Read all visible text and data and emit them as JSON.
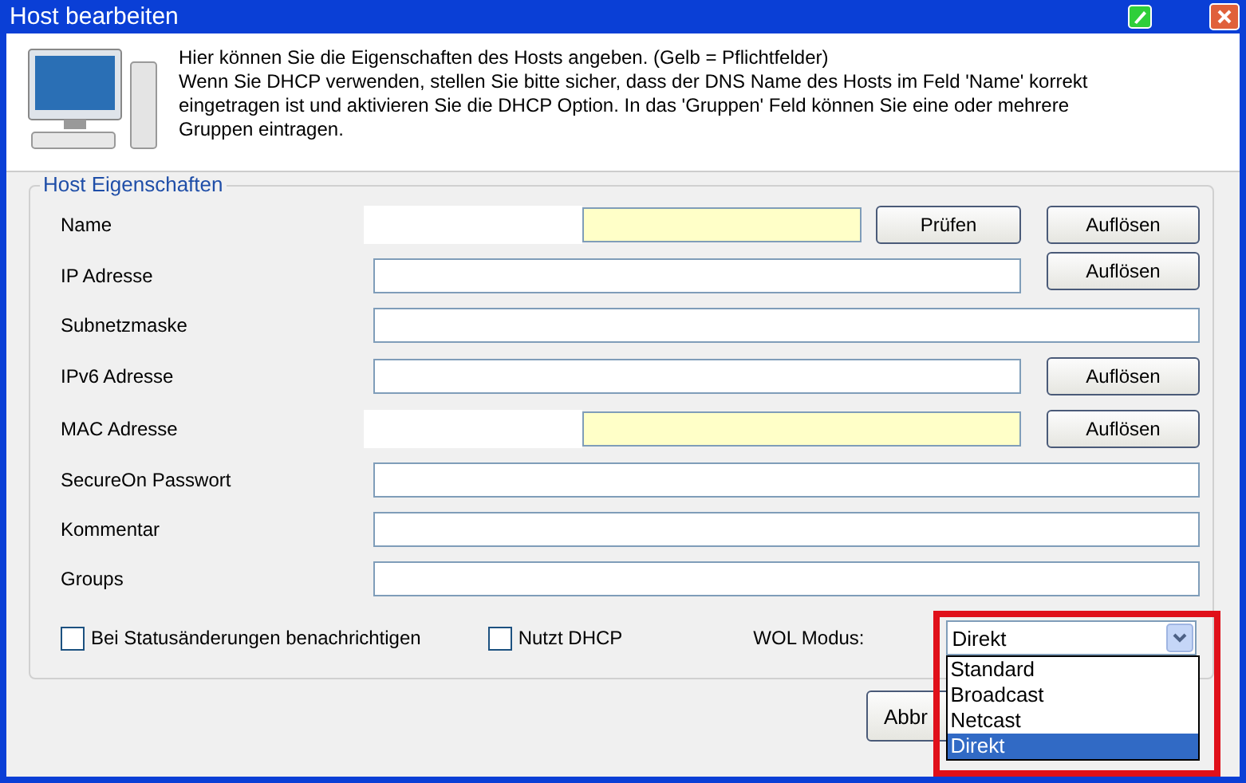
{
  "window": {
    "title": "Host bearbeiten"
  },
  "intro": {
    "lines": [
      "Hier können Sie die Eigenschaften des Hosts angeben. (Gelb = Pflichtfelder)",
      "Wenn Sie DHCP verwenden, stellen Sie bitte sicher, dass der DNS Name des Hosts im Feld 'Name' korrekt eingetragen ist und aktivieren Sie die DHCP Option. In das 'Gruppen' Feld können Sie eine oder mehrere Gruppen eintragen."
    ]
  },
  "group": {
    "title": "Host Eigenschaften",
    "fields": [
      {
        "label": "Name",
        "required": true,
        "redacted": true,
        "buttons": [
          "Prüfen",
          "Auflösen"
        ]
      },
      {
        "label": "IP Adresse",
        "required": false,
        "buttons": [
          "Auflösen"
        ]
      },
      {
        "label": "Subnetzmaske",
        "required": false
      },
      {
        "label": "IPv6 Adresse",
        "required": false,
        "buttons": [
          "Auflösen"
        ]
      },
      {
        "label": "MAC Adresse",
        "required": true,
        "redacted": true,
        "buttons": [
          "Auflösen"
        ]
      },
      {
        "label": "SecureOn Passwort",
        "required": false
      },
      {
        "label": "Kommentar",
        "required": false
      },
      {
        "label": "Groups",
        "required": false
      }
    ],
    "checkboxes": [
      {
        "label": "Bei Statusänderungen benachrichtigen",
        "checked": false
      },
      {
        "label": "Nutzt DHCP",
        "checked": false
      }
    ],
    "wol": {
      "label": "WOL Modus:",
      "value": "Direkt",
      "expanded": true,
      "highlighted": true,
      "options": [
        {
          "label": "Standard",
          "selected": false
        },
        {
          "label": "Broadcast",
          "selected": false
        },
        {
          "label": "Netcast",
          "selected": false
        },
        {
          "label": "Direkt",
          "selected": true
        }
      ]
    }
  },
  "buttons": [
    {
      "label": "Abbr"
    }
  ]
}
